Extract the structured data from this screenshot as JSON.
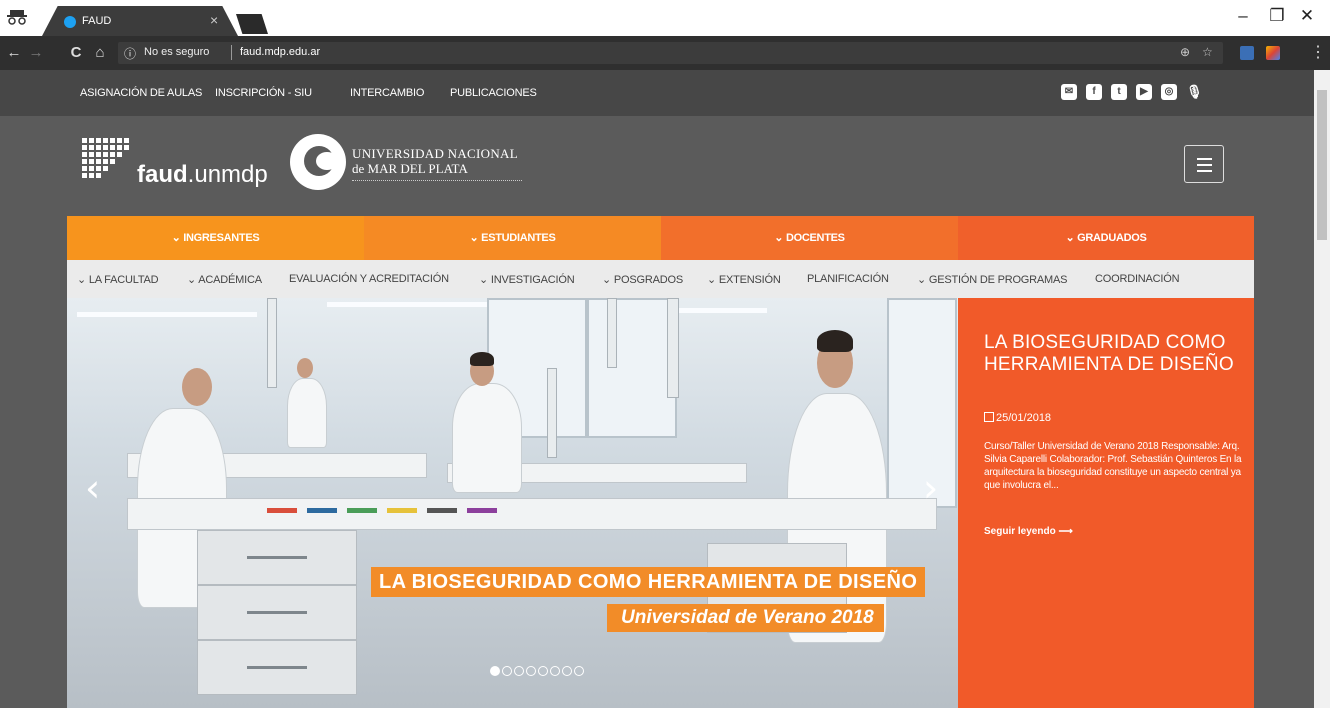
{
  "browser": {
    "tab_title": "FAUD",
    "tab_close": "×",
    "security_label": "No es seguro",
    "url": "faud.mdp.edu.ar",
    "info_icon": "ⓘ",
    "minimize": "–",
    "restore": "❐",
    "close": "✕",
    "back": "←",
    "forward": "→",
    "reload": "C",
    "home": "⌂",
    "zoom_icon": "⊕",
    "star_icon": "☆",
    "menu": "⋮",
    "icons": [
      "incognito-icon",
      "back-icon",
      "forward-icon",
      "reload-icon",
      "home-icon",
      "info-icon",
      "zoom-icon",
      "star-icon",
      "extension-icon",
      "extension-icon",
      "menu-icon"
    ]
  },
  "topbar": {
    "links": [
      "ASIGNACIÓN DE AULAS",
      "INSCRIPCIÓN - SIU",
      "INTERCAMBIO",
      "PUBLICACIONES"
    ],
    "social": [
      {
        "name": "email-icon",
        "glyph": "✉"
      },
      {
        "name": "facebook-icon",
        "glyph": "f"
      },
      {
        "name": "twitter-icon",
        "glyph": "t"
      },
      {
        "name": "youtube-icon",
        "glyph": "▶"
      },
      {
        "name": "instagram-icon",
        "glyph": "◎"
      },
      {
        "name": "microphone-icon",
        "glyph": "🎙"
      }
    ]
  },
  "header": {
    "logo_bold": "faud",
    "logo_light": ".unmdp",
    "university_line1": "UNIVERSIDAD NACIONAL",
    "university_line2": "de MAR DEL PLATA"
  },
  "main_menu": [
    {
      "label": "⌄ INGRESANTES",
      "color": "#f7941d"
    },
    {
      "label": "⌄ ESTUDIANTES",
      "color": "#f58a24"
    },
    {
      "label": "⌄ DOCENTES",
      "color": "#f26f2b"
    },
    {
      "label": "⌄ GRADUADOS",
      "color": "#f0602b"
    }
  ],
  "sub_menu": [
    "⌄ LA FACULTAD",
    "⌄ ACADÉMICA",
    "EVALUACIÓN Y ACREDITACIÓN",
    "⌄ INVESTIGACIÓN",
    "⌄ POSGRADOS",
    "⌄ EXTENSIÓN",
    "PLANIFICACIÓN",
    "⌄ GESTIÓN DE PROGRAMAS",
    "COORDINACIÓN"
  ],
  "slider": {
    "caption_main": "LA BIOSEGURIDAD COMO HERRAMIENTA DE DISEÑO",
    "caption_sub": "Universidad de Verano 2018",
    "prev": "‹",
    "next": "›",
    "total_slides": 8,
    "active_slide": 1
  },
  "news": {
    "title": "LA BIOSEGURIDAD COMO HERRAMIENTA DE DISEÑO",
    "date": "25/01/2018",
    "body": "Curso/Taller Universidad de Verano 2018 Responsable: Arq. Silvia Caparelli Colaborador: Prof. Sebastián Quinteros En la arquitectura la bioseguridad constituye un aspecto central ya que involucra el...",
    "read_more": "Seguir leyendo ⟶"
  },
  "colors": {
    "topbar": "#474747",
    "header_bg": "#5b5b5b",
    "accent_orange": "#f15a29",
    "caption_orange": "#f28c28"
  }
}
